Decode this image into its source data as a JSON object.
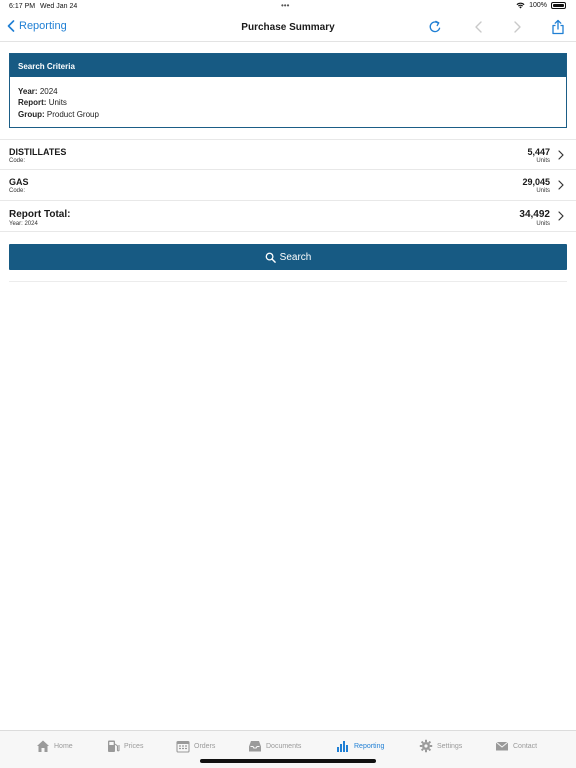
{
  "status_bar": {
    "time": "6:17 PM",
    "date": "Wed Jan 24",
    "battery": "100%"
  },
  "nav": {
    "back_label": "Reporting",
    "title": "Purchase Summary"
  },
  "criteria": {
    "header": "Search Criteria",
    "year_label": "Year:",
    "year_value": "2024",
    "report_label": "Report:",
    "report_value": "Units",
    "group_label": "Group:",
    "group_value": "Product Group"
  },
  "results": [
    {
      "name": "DISTILLATES",
      "sub": "Code:",
      "value": "5,447",
      "unit": "Units"
    },
    {
      "name": "GAS",
      "sub": "Code:",
      "value": "29,045",
      "unit": "Units"
    }
  ],
  "total": {
    "name": "Report Total:",
    "sub": "Year: 2024",
    "value": "34,492",
    "unit": "Units"
  },
  "search_button": {
    "label": "Search"
  },
  "tabs": [
    {
      "label": "Home",
      "icon": "home-icon"
    },
    {
      "label": "Prices",
      "icon": "fuel-pump-icon"
    },
    {
      "label": "Orders",
      "icon": "calendar-icon"
    },
    {
      "label": "Documents",
      "icon": "inbox-icon"
    },
    {
      "label": "Reporting",
      "icon": "bar-chart-icon",
      "active": true
    },
    {
      "label": "Settings",
      "icon": "gear-icon"
    },
    {
      "label": "Contact",
      "icon": "envelope-icon"
    }
  ],
  "colors": {
    "accent": "#1f7fd4",
    "header_bg": "#175a83",
    "inactive_tab": "#9a9a9a"
  }
}
